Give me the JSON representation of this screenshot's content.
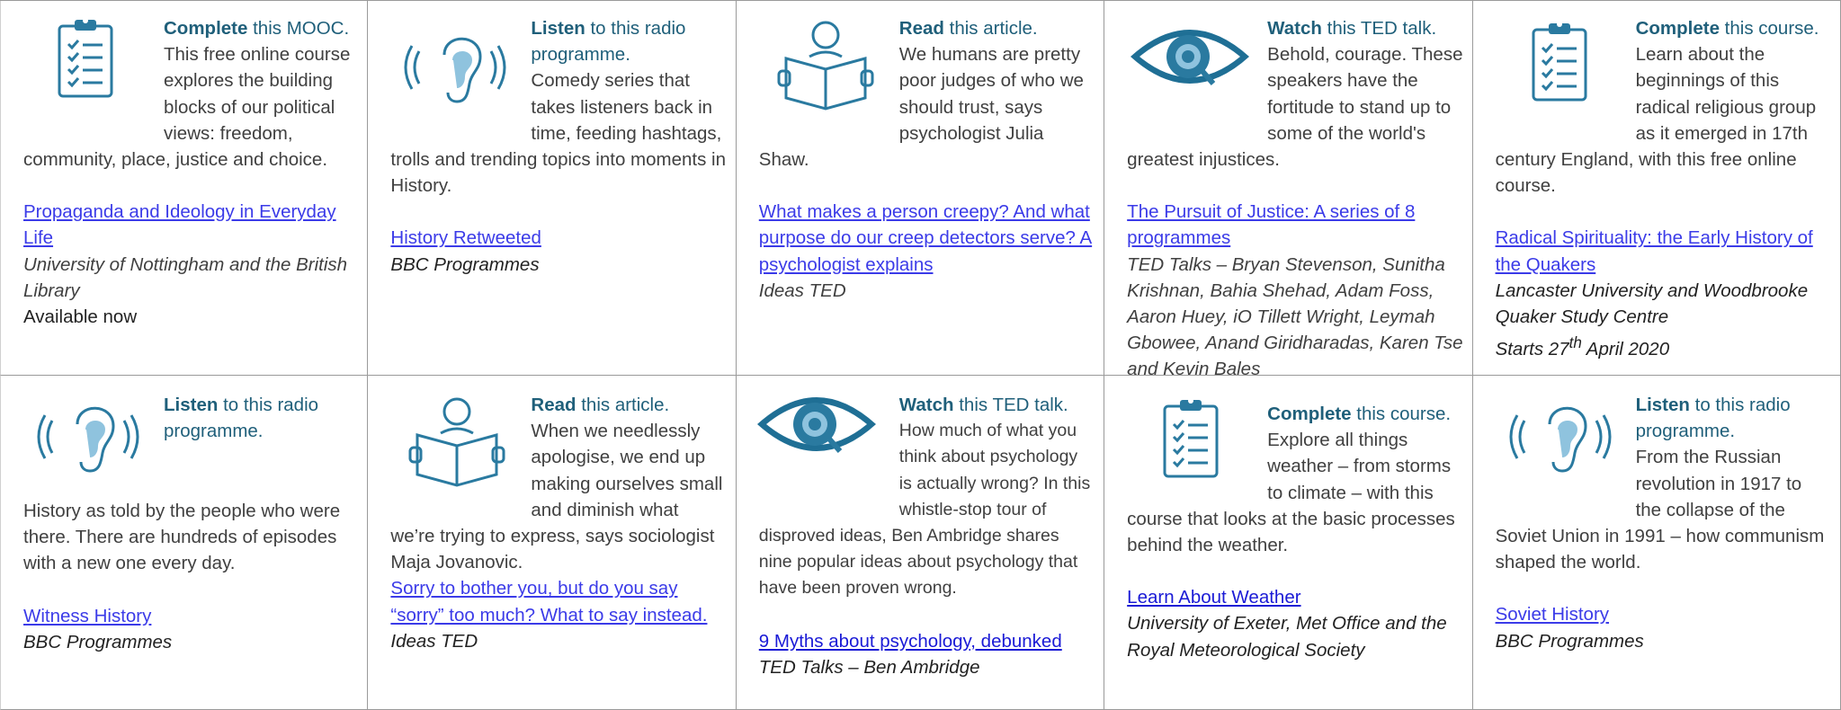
{
  "cells": [
    {
      "icon": "clipboard-icon",
      "verb": "Complete",
      "rest": " this MOOC.",
      "desc": "This free online course explores the building blocks of our political views: freedom, community, place, justice and choice.",
      "link": "Propaganda and Ideology in Everyday Life",
      "source": "University of Nottingham and the British Library",
      "extra": "Available now"
    },
    {
      "icon": "ear-icon",
      "verb": "Listen",
      "rest": " to this radio programme.",
      "desc": "Comedy series that takes listeners back in time, feeding hashtags, trolls and trending topics into moments in History.",
      "link": "History Retweeted",
      "source": "BBC Programmes"
    },
    {
      "icon": "reader-icon",
      "verb": "Read",
      "rest": " this article.",
      "desc": "We humans are pretty poor judges of who we should trust, says psychologist Julia Shaw.",
      "link": "What makes a person creepy? And what purpose do our creep detectors serve? A psychologist explains",
      "source": "Ideas TED"
    },
    {
      "icon": "eye-icon",
      "verb": "Watch",
      "rest": " this TED talk.",
      "desc": "Behold, courage. These speakers have the fortitude to stand up to some of the world's greatest injustices.",
      "link": "The Pursuit of Justice: A series of 8 programmes",
      "source": "TED Talks – Bryan Stevenson, Sunitha Krishnan, Bahia Shehad, Adam Foss, Aaron Huey, iO Tillett Wright, Leymah Gbowee, Anand Giridharadas, Karen Tse and Kevin Bales"
    },
    {
      "icon": "clipboard-icon",
      "verb": "Complete",
      "rest": " this course.",
      "desc": "Learn about the beginnings of this radical religious group as it emerged in 17th century England, with this free online course.",
      "link": "Radical Spirituality: the Early History of the Quakers",
      "source": "Lancaster University and Woodbrooke Quaker Study Centre",
      "extra_pre": "Starts 27",
      "extra_sup": "th",
      "extra_post": " April 2020"
    },
    {
      "icon": "ear-icon",
      "verb": "Listen",
      "rest": " to this radio programme.",
      "desc": "History as told by the people who were there. There are hundreds of episodes with a new one every day.",
      "link": "Witness History",
      "source": "BBC Programmes"
    },
    {
      "icon": "reader-icon",
      "verb": "Read",
      "rest": " this article.",
      "desc": "When we needlessly apologise, we end up making ourselves small and diminish what we’re trying to express, says sociologist Maja Jovanovic.",
      "link": "Sorry to bother you, but do you say “sorry” too much? What to say instead.",
      "source": "Ideas TED"
    },
    {
      "icon": "eye-icon",
      "verb": "Watch",
      "rest": " this TED talk.",
      "desc": "How much of what you think about psychology is actually wrong? In this whistle-stop tour of disproved ideas, Ben Ambridge shares nine popular ideas about psychology that have been proven wrong.",
      "link": "9 Myths about psychology, debunked",
      "source": "TED Talks – Ben Ambridge"
    },
    {
      "icon": "clipboard-icon",
      "verb": "Complete",
      "rest": " this course.",
      "desc": "Explore all things weather – from storms to climate – with this course that looks at the basic processes behind the weather.",
      "link": "Learn About Weather",
      "source": "University of Exeter, Met Office and the Royal Meteorological Society"
    },
    {
      "icon": "ear-icon",
      "verb": "Listen",
      "rest": " to this radio programme.",
      "desc": "From the Russian revolution in 1917 to the collapse of the Soviet Union in 1991 – how communism shaped the world.",
      "link": "Soviet History",
      "source": "BBC Programmes"
    }
  ],
  "colors": {
    "heading": "#1f5f7a",
    "icon_stroke": "#2a7aa0",
    "icon_light": "#8fc3de",
    "link": "#3b3be8",
    "border": "#9a9a9a"
  }
}
